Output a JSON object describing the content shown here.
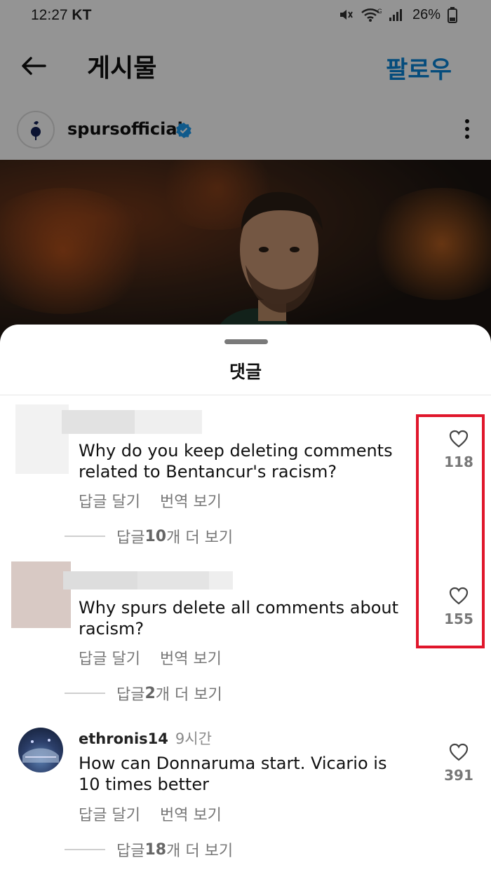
{
  "status_bar": {
    "time": "12:27",
    "carrier": "KT",
    "battery": "26%"
  },
  "header": {
    "title": "게시물",
    "follow_label": "팔로우"
  },
  "post": {
    "username": "spursofficial"
  },
  "sheet": {
    "title": "댓글"
  },
  "comments": [
    {
      "username": "",
      "time": "",
      "text": "Why do you keep deleting comments related to Bentancur's racism?",
      "reply_label": "답글 달기",
      "translate_label": "번역 보기",
      "more_replies_prefix": "답글 ",
      "more_replies_count": "10",
      "more_replies_suffix": "개 더 보기",
      "likes": "118"
    },
    {
      "username": "",
      "time": "",
      "text": "Why spurs delete all comments about racism?",
      "reply_label": "답글 달기",
      "translate_label": "번역 보기",
      "more_replies_prefix": "답글 ",
      "more_replies_count": "2",
      "more_replies_suffix": "개 더 보기",
      "likes": "155"
    },
    {
      "username": "ethronis14",
      "time": "9시간",
      "text": "How can Donnaruma start. Vicario is 10 times better",
      "reply_label": "답글 달기",
      "translate_label": "번역 보기",
      "more_replies_prefix": "답글 ",
      "more_replies_count": "18",
      "more_replies_suffix": "개 더 보기",
      "likes": "391"
    }
  ],
  "colors": {
    "accent": "#0a84d6",
    "highlight": "#e0162b",
    "verified": "#1d9bf0"
  }
}
